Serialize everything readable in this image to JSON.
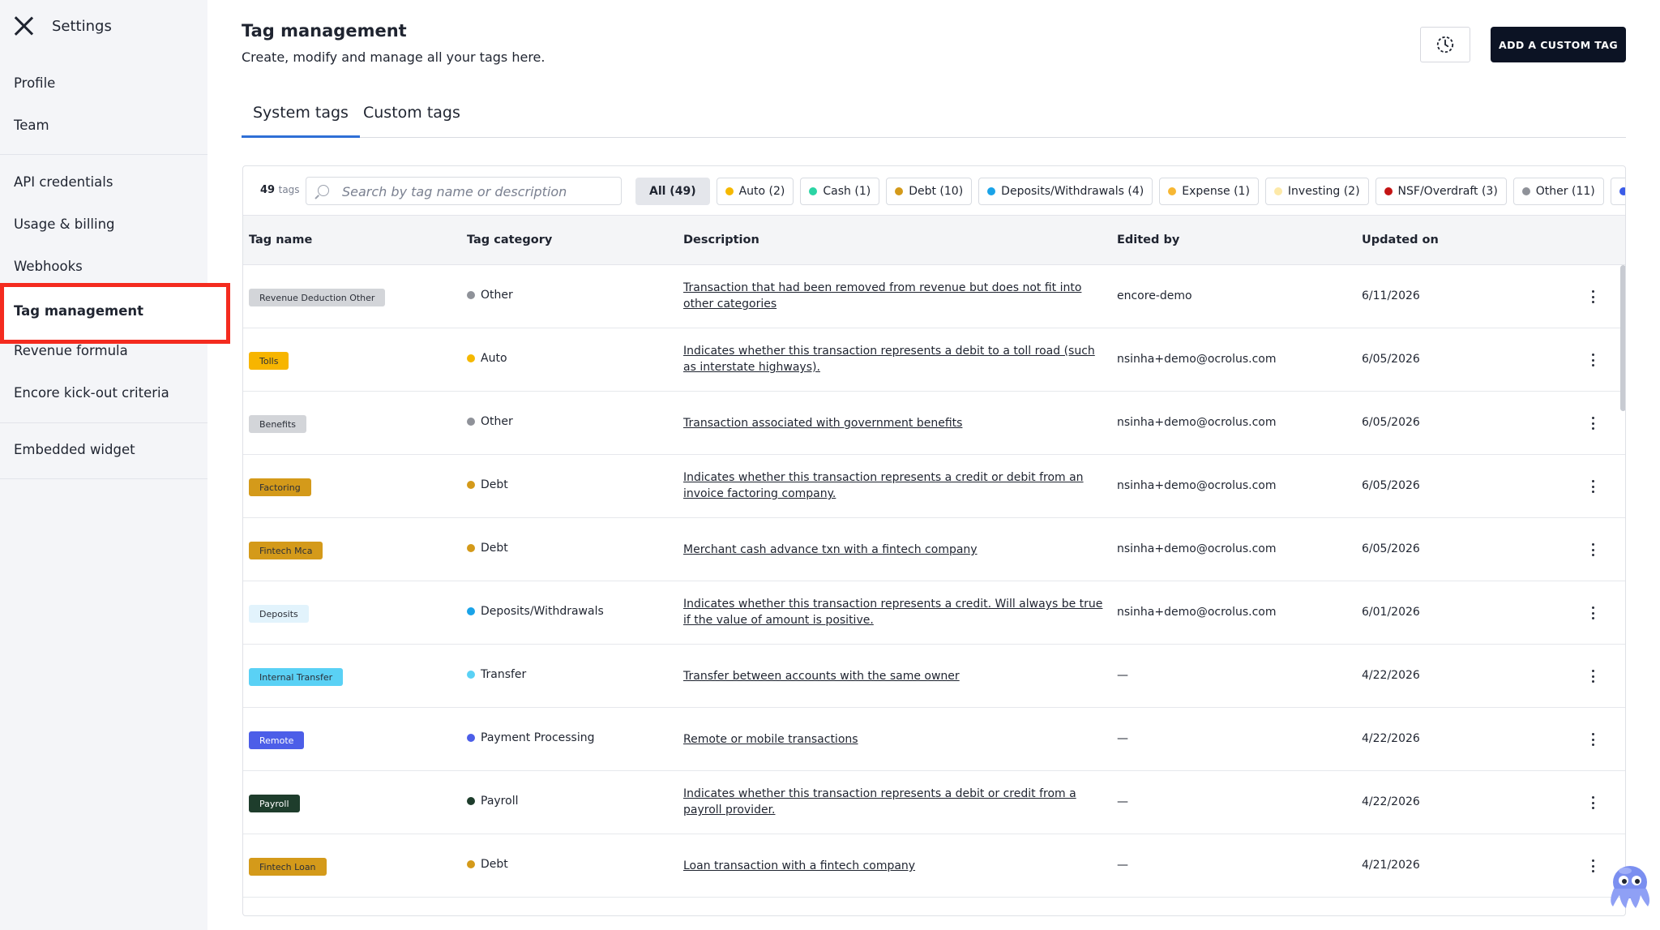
{
  "sidebar": {
    "title": "Settings",
    "items": [
      {
        "label": "Profile"
      },
      {
        "label": "Team"
      },
      {
        "label": "API credentials"
      },
      {
        "label": "Usage & billing"
      },
      {
        "label": "Webhooks"
      },
      {
        "label": "Tag management",
        "active": true
      },
      {
        "label": "Revenue formula"
      },
      {
        "label": "Encore kick-out criteria"
      },
      {
        "label": "Embedded widget"
      }
    ]
  },
  "header": {
    "title": "Tag management",
    "subtitle": "Create, modify and manage all your tags here.",
    "history_icon": "history-clock-icon",
    "add_button": "ADD A CUSTOM TAG"
  },
  "tabs": [
    {
      "label": "System tags",
      "active": true
    },
    {
      "label": "Custom tags",
      "active": false
    }
  ],
  "filter": {
    "count": "49",
    "count_unit": "tags",
    "search_placeholder": "Search by tag name or description",
    "chips": [
      {
        "label": "All (49)",
        "color": null,
        "active": true
      },
      {
        "label": "Auto (2)",
        "color": "#f5b800"
      },
      {
        "label": "Cash (1)",
        "color": "#2bd4a4"
      },
      {
        "label": "Debt (10)",
        "color": "#d49a1a"
      },
      {
        "label": "Deposits/Withdrawals (4)",
        "color": "#1aa3e8"
      },
      {
        "label": "Expense (1)",
        "color": "#f7b733"
      },
      {
        "label": "Investing (2)",
        "color": "#fde9a8"
      },
      {
        "label": "NSF/Overdraft (3)",
        "color": "#c41414"
      },
      {
        "label": "Other (11)",
        "color": "#8f9299"
      }
    ],
    "overflow_chip_color": "#3b5ce8"
  },
  "table": {
    "columns": [
      "Tag name",
      "Tag category",
      "Description",
      "Edited by",
      "Updated on"
    ],
    "rows": [
      {
        "tag": "Revenue Deduction Other",
        "tag_bg": "#d3d5d9",
        "tag_fg": "#2b2f38",
        "category": "Other",
        "cat_color": "#8f9299",
        "description": "Transaction that had been removed from revenue but does not fit into other categories",
        "edited_by": "encore-demo",
        "updated_on": "6/11/2026"
      },
      {
        "tag": "Tolls",
        "tag_bg": "#f7b500",
        "tag_fg": "#2b2f38",
        "category": "Auto",
        "cat_color": "#f5b800",
        "description": "Indicates whether this transaction represents a debit to a toll road (such as interstate highways).",
        "edited_by": "nsinha+demo@ocrolus.com",
        "updated_on": "6/05/2026"
      },
      {
        "tag": "Benefits",
        "tag_bg": "#d3d5d9",
        "tag_fg": "#2b2f38",
        "category": "Other",
        "cat_color": "#8f9299",
        "description": "Transaction associated with government benefits",
        "edited_by": "nsinha+demo@ocrolus.com",
        "updated_on": "6/05/2026"
      },
      {
        "tag": "Factoring",
        "tag_bg": "#d49a1a",
        "tag_fg": "#2b2f38",
        "category": "Debt",
        "cat_color": "#d49a1a",
        "description": "Indicates whether this transaction represents a credit or debit from an invoice factoring company.",
        "edited_by": "nsinha+demo@ocrolus.com",
        "updated_on": "6/05/2026"
      },
      {
        "tag": "Fintech Mca",
        "tag_bg": "#d49a1a",
        "tag_fg": "#2b2f38",
        "category": "Debt",
        "cat_color": "#d49a1a",
        "description": "Merchant cash advance txn with a fintech company",
        "edited_by": "nsinha+demo@ocrolus.com",
        "updated_on": "6/05/2026"
      },
      {
        "tag": "Deposits",
        "tag_bg": "#e2f3fc",
        "tag_fg": "#2b2f38",
        "category": "Deposits/Withdrawals",
        "cat_color": "#1aa3e8",
        "description": "Indicates whether this transaction represents a credit. Will always be true if the value of amount is positive.",
        "edited_by": "nsinha+demo@ocrolus.com",
        "updated_on": "6/01/2026"
      },
      {
        "tag": "Internal Transfer",
        "tag_bg": "#5ad1f5",
        "tag_fg": "#2b2f38",
        "category": "Transfer",
        "cat_color": "#5ad1f5",
        "description": "Transfer between accounts with the same owner",
        "edited_by": "—",
        "updated_on": "4/22/2026"
      },
      {
        "tag": "Remote",
        "tag_bg": "#4c5ee8",
        "tag_fg": "#ffffff",
        "category": "Payment Processing",
        "cat_color": "#4c5ee8",
        "description": "Remote or mobile transactions",
        "edited_by": "—",
        "updated_on": "4/22/2026"
      },
      {
        "tag": "Payroll",
        "tag_bg": "#1e3d2c",
        "tag_fg": "#ffffff",
        "category": "Payroll",
        "cat_color": "#1e3d2c",
        "description": "Indicates whether this transaction represents a debit or credit from a payroll provider.",
        "edited_by": "—",
        "updated_on": "4/22/2026"
      },
      {
        "tag": "Fintech Loan",
        "tag_bg": "#d49a1a",
        "tag_fg": "#2b2f38",
        "category": "Debt",
        "cat_color": "#d49a1a",
        "description": "Loan transaction with a fintech company",
        "edited_by": "—",
        "updated_on": "4/21/2026"
      }
    ]
  },
  "assistant": {
    "icon": "octopus-mascot-icon"
  }
}
